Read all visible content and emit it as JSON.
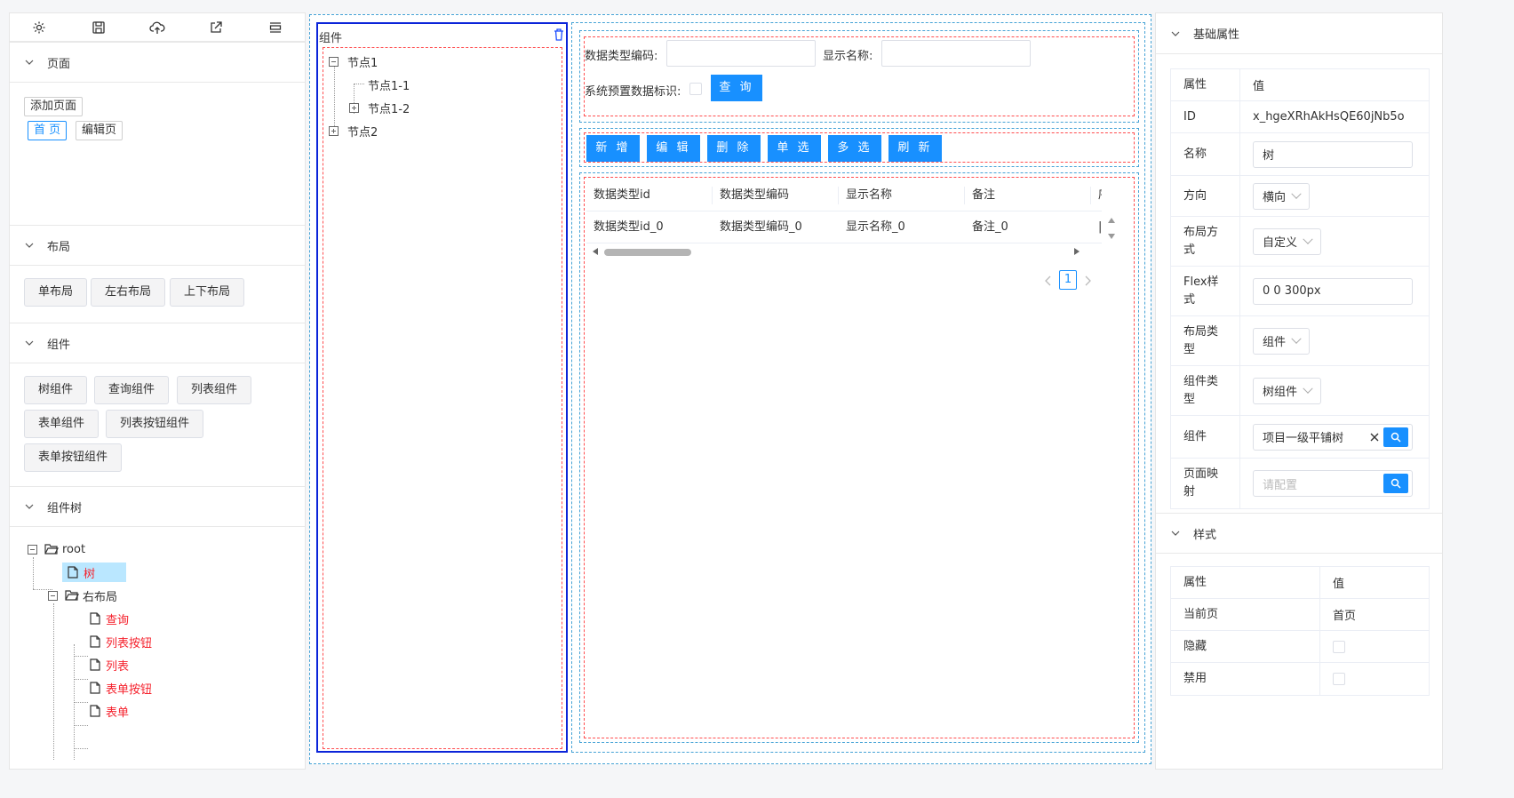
{
  "toolbar": {
    "icons": [
      "gear-icon",
      "save-icon",
      "cloud-upload-icon",
      "external-link-icon",
      "layout-icon"
    ]
  },
  "sections": {
    "page": {
      "title": "页面",
      "add_button": "添加页面",
      "tabs": [
        "首 页",
        "编辑页"
      ]
    },
    "layout": {
      "title": "布局",
      "buttons": [
        "单布局",
        "左右布局",
        "上下布局"
      ]
    },
    "component": {
      "title": "组件",
      "buttons": [
        "树组件",
        "查询组件",
        "列表组件",
        "表单组件",
        "列表按钮组件",
        "表单按钮组件"
      ]
    },
    "component_tree": {
      "title": "组件树",
      "root": "root",
      "tree_node": "树",
      "right_layout": "右布局",
      "children": [
        "查询",
        "列表按钮",
        "列表",
        "表单按钮",
        "表单"
      ]
    }
  },
  "canvas": {
    "tree_panel": {
      "title": "组件",
      "nodes": {
        "n1": "节点1",
        "n1_1": "节点1-1",
        "n1_2": "节点1-2",
        "n2": "节点2"
      }
    },
    "query": {
      "code_label": "数据类型编码:",
      "name_label": "显示名称:",
      "preset_label": "系统预置数据标识:",
      "query_button": "查 询"
    },
    "list_buttons": [
      "新 增",
      "编 辑",
      "删 除",
      "单 选",
      "多 选",
      "刷 新"
    ],
    "table": {
      "columns": [
        "数据类型id",
        "数据类型编码",
        "显示名称",
        "备注",
        "序"
      ],
      "rows": [
        [
          "数据类型id_0",
          "数据类型编码_0",
          "显示名称_0",
          "备注_0",
          "|"
        ]
      ],
      "page": "1"
    }
  },
  "properties": {
    "basic_title": "基础属性",
    "header_key": "属性",
    "header_val": "值",
    "rows": {
      "id_key": "ID",
      "id_val": "x_hgeXRhAkHsQE60jNb5o",
      "name_key": "名称",
      "name_val": "树",
      "direction_key": "方向",
      "direction_val": "横向",
      "layout_mode_key": "布局方式",
      "layout_mode_val": "自定义",
      "flex_key": "Flex样式",
      "flex_val": "0 0 300px",
      "layout_type_key": "布局类型",
      "layout_type_val": "组件",
      "comp_type_key": "组件类型",
      "comp_type_val": "树组件",
      "comp_key": "组件",
      "comp_val": "项目一级平铺树",
      "page_map_key": "页面映射",
      "page_map_placeholder": "请配置"
    },
    "style_title": "样式",
    "style_rows": {
      "current_page_key": "当前页",
      "current_page_val": "首页",
      "hidden_key": "隐藏",
      "disabled_key": "禁用"
    }
  }
}
